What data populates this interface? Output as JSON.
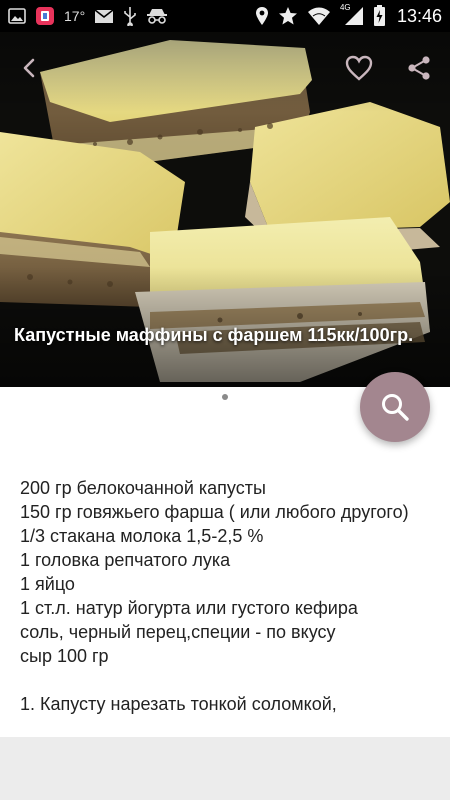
{
  "status_bar": {
    "temperature": "17°",
    "time": "13:46",
    "network_label": "4G",
    "icons": [
      "gallery-icon",
      "app-icon",
      "mail-icon",
      "usb-icon",
      "incognito-icon",
      "location-icon",
      "star-icon",
      "wifi-icon",
      "signal-icon",
      "battery-icon"
    ]
  },
  "hero": {
    "title": "Капустные маффины с фаршем 115кк/100гр.",
    "actions": [
      "back-arrow-icon",
      "favorite-heart-icon",
      "share-icon"
    ]
  },
  "recipe": {
    "lines": [
      "200 гр белокочанной капусты",
      "150 гр говяжьего фарша ( или любого другого)",
      "1/3 стакана молока 1,5-2,5 %",
      "1 головка репчатого лука",
      "1 яйцо",
      "1 ст.л. натур йогурта или густого кефира",
      "соль, черный перец,специи - по вкусу",
      "сыр 100 гр",
      "",
      "1. Капусту нарезать тонкой соломкой,"
    ]
  },
  "fab": {
    "icon": "search-icon",
    "color": "#a3868f"
  }
}
